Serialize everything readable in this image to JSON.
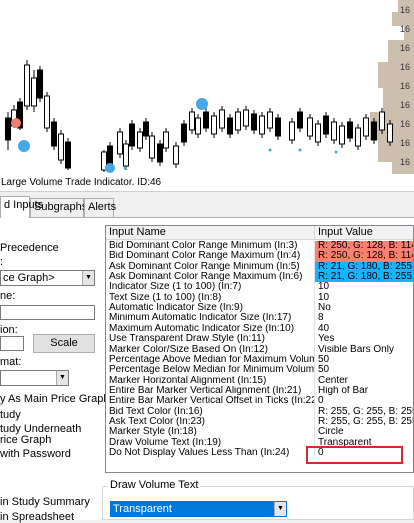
{
  "chart": {
    "price_labels": [
      "16",
      "16",
      "16",
      "16",
      "16",
      "16",
      "16",
      "16",
      "16"
    ],
    "colors": {
      "candle": "#000000",
      "marker_blue": "#45a8e8",
      "marker_red": "#f07d78",
      "profile": "#ccbfae",
      "dot": "#2fb8c8"
    }
  },
  "title_bar": {
    "text": "Large Volume Trade Indicator. ID:46"
  },
  "tabs": [
    {
      "label": "d Inputs"
    },
    {
      "label": "Subgraphs"
    },
    {
      "label": "Alerts"
    }
  ],
  "left_panel": {
    "precedence_label": "Precedence",
    "graph_label": ":",
    "graph_select": "ce Graph>",
    "name_label": "ne:",
    "region_label": "ion:",
    "scale_button": "Scale",
    "format_label": "mat:",
    "format_select": "",
    "option_as_main": "y As Main Price Graph",
    "option_study": "tudy",
    "option_underneath": "tudy Underneath",
    "option_price_graph": "rice Graph",
    "option_password": "with Password",
    "option_study_summary": "in Study Summary",
    "option_spreadsheet": "in Spreadsheet"
  },
  "grid": {
    "header_name": "Input Name",
    "header_value": "Input Value",
    "rows": [
      {
        "name": "Bid Dominant Color Range Minimum  (In:3)",
        "value": "R: 250, G: 128, B: 114",
        "bg": "#fa8072"
      },
      {
        "name": "Bid Dominant Color Range Maximum  (In:4)",
        "value": "R: 250, G: 128, B: 114",
        "bg": "#fa8072"
      },
      {
        "name": "Ask Dominant Color Range Minimum  (In:5)",
        "value": "R: 21, G: 180, B: 255",
        "bg": "#15b4ff"
      },
      {
        "name": "Ask Dominant Color Range Maximum  (In:6)",
        "value": "R: 21, G: 180, B: 255",
        "bg": "#15b4ff"
      },
      {
        "name": "Indicator Size (1 to 100)  (In:7)",
        "value": "10",
        "bg": ""
      },
      {
        "name": "Text Size (1 to 100)  (In:8)",
        "value": "10",
        "bg": ""
      },
      {
        "name": "Automatic Indicator Size  (In:9)",
        "value": "No",
        "bg": ""
      },
      {
        "name": "Minimum Automatic Indicator Size  (In:17)",
        "value": "8",
        "bg": ""
      },
      {
        "name": "Maximum Automatic Indicator Size  (In:10)",
        "value": "40",
        "bg": ""
      },
      {
        "name": "Use Transparent Draw Style  (In:11)",
        "value": "Yes",
        "bg": ""
      },
      {
        "name": "Marker Color/Size Based On  (In:12)",
        "value": "Visible Bars Only",
        "bg": ""
      },
      {
        "name": "Percentage Above Median for Maximum Volume In ...",
        "value": "50",
        "bg": ""
      },
      {
        "name": "Percentage Below Median for Minimum Volume In C...",
        "value": "50",
        "bg": ""
      },
      {
        "name": "Marker Horizontal Alignment  (In:15)",
        "value": "Center",
        "bg": ""
      },
      {
        "name": "Entire Bar Marker Vertical Alignment  (In:21)",
        "value": "High of Bar",
        "bg": ""
      },
      {
        "name": "Entire Bar Marker Vertical Offset in Ticks  (In:22)",
        "value": "0",
        "bg": ""
      },
      {
        "name": "Bid Text Color  (In:16)",
        "value": "R: 255, G: 255, B: 255",
        "bg": ""
      },
      {
        "name": "Ask Text Color  (In:23)",
        "value": "R: 255, G: 255, B: 255",
        "bg": ""
      },
      {
        "name": "Marker Style  (In:18)",
        "value": "Circle",
        "bg": ""
      },
      {
        "name": "Draw Volume Text  (In:19)",
        "value": "Transparent",
        "bg": ""
      },
      {
        "name": "Do Not Display Values Less Than  (In:24)",
        "value": "0",
        "bg": ""
      }
    ]
  },
  "draw_volume_text": {
    "legend": "Draw Volume Text",
    "selected": "Transparent",
    "select_bg": "#0078d7"
  }
}
